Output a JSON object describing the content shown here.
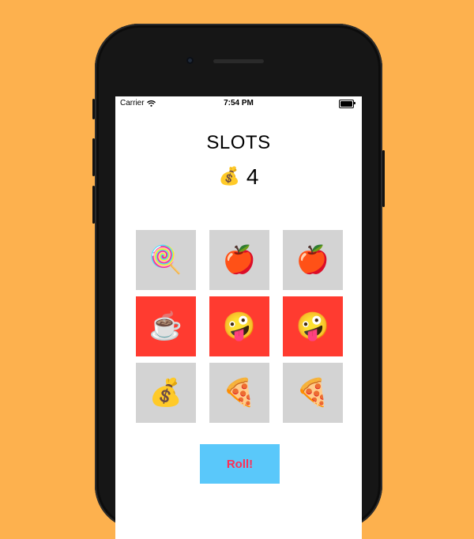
{
  "status_bar": {
    "carrier": "Carrier",
    "time": "7:54 PM",
    "wifi_icon": "wifi-icon",
    "battery_icon": "battery-icon",
    "battery_level": 1.0
  },
  "game": {
    "title": "SLOTS",
    "credits_icon": "💰",
    "credits": "4",
    "rows": [
      [
        {
          "symbol": "🍭",
          "highlighted": false
        },
        {
          "symbol": "🍎",
          "highlighted": false
        },
        {
          "symbol": "🍎",
          "highlighted": false
        }
      ],
      [
        {
          "symbol": "☕",
          "highlighted": true
        },
        {
          "symbol": "🤪",
          "highlighted": true
        },
        {
          "symbol": "🤪",
          "highlighted": true
        }
      ],
      [
        {
          "symbol": "💰",
          "highlighted": false
        },
        {
          "symbol": "🍕",
          "highlighted": false
        },
        {
          "symbol": "🍕",
          "highlighted": false
        }
      ]
    ],
    "roll_label": "Roll!"
  },
  "colors": {
    "background": "#fdb14e",
    "tile": "#d3d3d3",
    "tile_highlight": "#ff3b30",
    "button_bg": "#5ac8fa",
    "button_text": "#ff2d55"
  }
}
